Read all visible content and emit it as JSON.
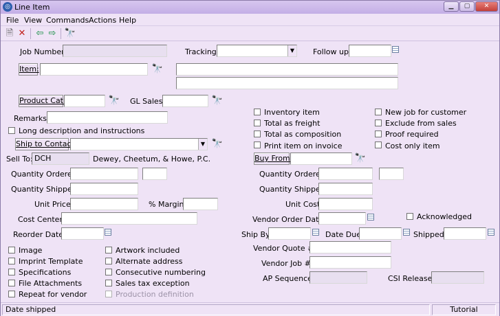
{
  "window": {
    "title": "Line Item"
  },
  "menu": [
    "File",
    "View",
    "Commands",
    "Actions",
    "Help"
  ],
  "icons": {
    "app": "app-globe-icon",
    "new": "new-document-icon",
    "delete": "delete-x-icon",
    "back": "arrow-left-icon",
    "forward": "arrow-right-icon",
    "find": "binoculars-icon",
    "calendar": "calendar-icon"
  },
  "form": {
    "job_number_label": "Job Number:",
    "job_number": "",
    "tracking_label": "Tracking:",
    "tracking": "",
    "follow_up_label": "Follow up:",
    "follow_up": "",
    "item_button": "Item:",
    "item": "",
    "desc1": "",
    "desc2": "",
    "product_cat_button": "Product Cat.:",
    "product_cat": "",
    "gl_sales_label": "GL Sales:",
    "gl_sales": "",
    "remarks_label": "Remarks:",
    "remarks": "",
    "long_desc_label": "Long description and instructions",
    "ship_to_button": "Ship to Contact:",
    "ship_to": "",
    "sell_to_label": "Sell To:",
    "sell_to": "DCH",
    "sell_to_name": "Dewey, Cheetum, & Howe, P.C.",
    "qty_ordered_label": "Quantity Ordered:",
    "qty_ordered": "",
    "qty_ordered_unit": "",
    "qty_shipped_label": "Quantity Shipped:",
    "qty_shipped": "",
    "unit_price_label": "Unit Price:",
    "unit_price": "",
    "margin_label": "% Margin:",
    "margin": "",
    "cost_center_label": "Cost Center:",
    "cost_center": "",
    "reorder_date_label": "Reorder Date:",
    "reorder_date": ""
  },
  "left_checks": [
    {
      "label": "Image",
      "disabled": false
    },
    {
      "label": "Imprint Template",
      "disabled": false
    },
    {
      "label": "Specifications",
      "disabled": false
    },
    {
      "label": "File Attachments",
      "disabled": false
    },
    {
      "label": "Repeat for vendor",
      "disabled": false
    }
  ],
  "mid_checks": [
    {
      "label": "Artwork included",
      "disabled": false
    },
    {
      "label": "Alternate address",
      "disabled": false
    },
    {
      "label": "Consecutive numbering",
      "disabled": false
    },
    {
      "label": "Sales tax exception",
      "disabled": false
    },
    {
      "label": "Production definition",
      "disabled": true
    }
  ],
  "right_checks_a": [
    "Inventory item",
    "Total as freight",
    "Total as composition",
    "Print item on invoice"
  ],
  "right_checks_b": [
    "New job for customer",
    "Exclude from sales",
    "Proof required",
    "Cost only item"
  ],
  "vendor": {
    "buy_from_button": "Buy From:",
    "buy_from": "",
    "qty_ordered_label": "Quantity Ordered:",
    "qty_ordered": "",
    "qty_ordered_unit": "",
    "qty_shipped_label": "Quantity Shipped:",
    "qty_shipped": "",
    "unit_cost_label": "Unit Cost:",
    "unit_cost": "",
    "vendor_order_date_label": "Vendor Order Date:",
    "vendor_order_date": "",
    "acknowledged_label": "Acknowledged",
    "ship_by_label": "Ship By:",
    "ship_by": "",
    "date_due_label": "Date Due:",
    "date_due": "",
    "shipped_label": "Shipped:",
    "shipped": "",
    "vendor_quote_label": "Vendor Quote #:",
    "vendor_quote": "",
    "vendor_job_label": "Vendor Job #:",
    "vendor_job": "",
    "ap_sequence_label": "AP Sequence:",
    "ap_sequence": "",
    "csi_release_label": "CSI Release:",
    "csi_release": ""
  },
  "status": {
    "text": "Date shipped",
    "mode": "Tutorial"
  }
}
